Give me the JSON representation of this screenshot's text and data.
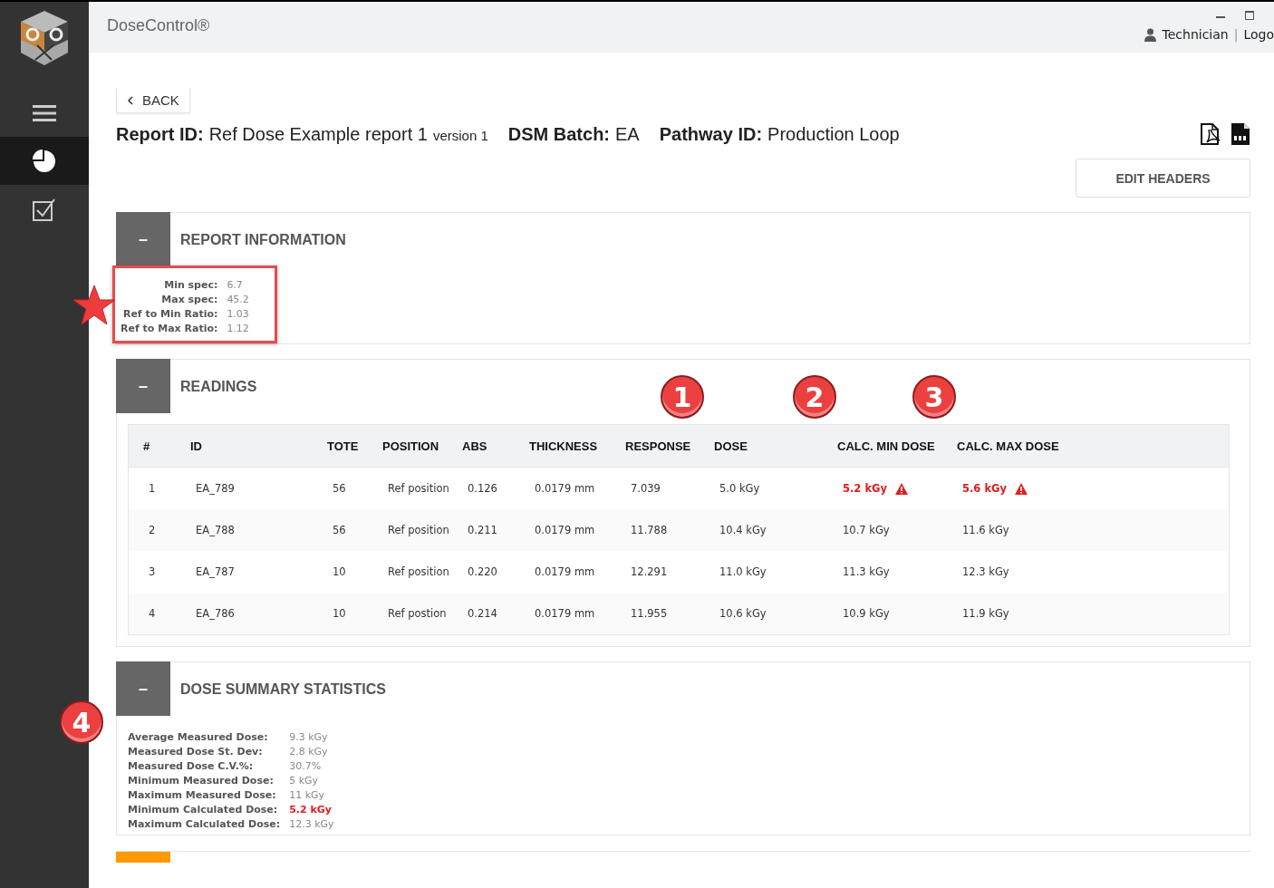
{
  "app": {
    "title": "DoseControl®"
  },
  "user": {
    "name": "Technician",
    "separator": "|",
    "logout": "Logo"
  },
  "sidebar": {
    "items": [
      {
        "kind": "menu",
        "selected": false
      },
      {
        "kind": "chart",
        "selected": true
      },
      {
        "kind": "tasks",
        "selected": false
      }
    ]
  },
  "back_button": {
    "label": "BACK"
  },
  "header_fields": [
    {
      "label": "Report ID:",
      "value": "Ref Dose Example report 1",
      "suffix": "version 1"
    },
    {
      "label": "DSM Batch:",
      "value": "EA"
    },
    {
      "label": "Pathway ID:",
      "value": "Production Loop"
    }
  ],
  "edit_headers_button": {
    "label": "EDIT HEADERS"
  },
  "report_information": {
    "title": "REPORT INFORMATION",
    "toggle": "–",
    "items": [
      {
        "label": "Min spec:",
        "value": "6.7"
      },
      {
        "label": "Max spec:",
        "value": "45.2"
      },
      {
        "label": "Ref to Min Ratio:",
        "value": "1.03"
      },
      {
        "label": "Ref to Max Ratio:",
        "value": "1.12"
      }
    ]
  },
  "readings": {
    "title": "READINGS",
    "toggle": "–",
    "columns": [
      "#",
      "ID",
      "TOTE",
      "POSITION",
      "ABS",
      "THICKNESS",
      "RESPONSE",
      "DOSE",
      "CALC. MIN DOSE",
      "CALC. MAX DOSE"
    ],
    "rows": [
      {
        "cells": [
          "1",
          "EA_789",
          "56",
          "Ref position",
          "0.126",
          "0.0179 mm",
          "7.039",
          "5.0 kGy",
          "5.2 kGy",
          "5.6 kGy"
        ],
        "alerts": [
          false,
          false,
          false,
          false,
          false,
          false,
          false,
          false,
          true,
          true
        ]
      },
      {
        "cells": [
          "2",
          "EA_788",
          "56",
          "Ref position",
          "0.211",
          "0.0179 mm",
          "11.788",
          "10.4 kGy",
          "10.7 kGy",
          "11.6 kGy"
        ],
        "alerts": [
          false,
          false,
          false,
          false,
          false,
          false,
          false,
          false,
          false,
          false
        ]
      },
      {
        "cells": [
          "3",
          "EA_787",
          "10",
          "Ref position",
          "0.220",
          "0.0179 mm",
          "12.291",
          "11.0 kGy",
          "11.3 kGy",
          "12.3 kGy"
        ],
        "alerts": [
          false,
          false,
          false,
          false,
          false,
          false,
          false,
          false,
          false,
          false
        ]
      },
      {
        "cells": [
          "4",
          "EA_786",
          "10",
          "Ref postion",
          "0.214",
          "0.0179 mm",
          "11.955",
          "10.6 kGy",
          "10.9 kGy",
          "11.9 kGy"
        ],
        "alerts": [
          false,
          false,
          false,
          false,
          false,
          false,
          false,
          false,
          false,
          false
        ]
      }
    ]
  },
  "dose_summary_statistics": {
    "title": "DOSE SUMMARY STATISTICS",
    "toggle": "–",
    "items": [
      {
        "label": "Average Measured Dose:",
        "value": "9.3 kGy",
        "alert": false
      },
      {
        "label": "Measured Dose St. Dev:",
        "value": "2.8 kGy",
        "alert": false
      },
      {
        "label": "Measured Dose C.V.%:",
        "value": "30.7%",
        "alert": false
      },
      {
        "label": "Minimum Measured Dose:",
        "value": "5 kGy",
        "alert": false
      },
      {
        "label": "Maximum Measured Dose:",
        "value": "11 kGy",
        "alert": false
      },
      {
        "label": "Minimum Calculated Dose:",
        "value": "5.2 kGy",
        "alert": true
      },
      {
        "label": "Maximum Calculated Dose:",
        "value": "12.3 kGy",
        "alert": false
      }
    ]
  },
  "next_section": {
    "color": "#ff9900"
  },
  "callouts": [
    "1",
    "2",
    "3",
    "4"
  ]
}
